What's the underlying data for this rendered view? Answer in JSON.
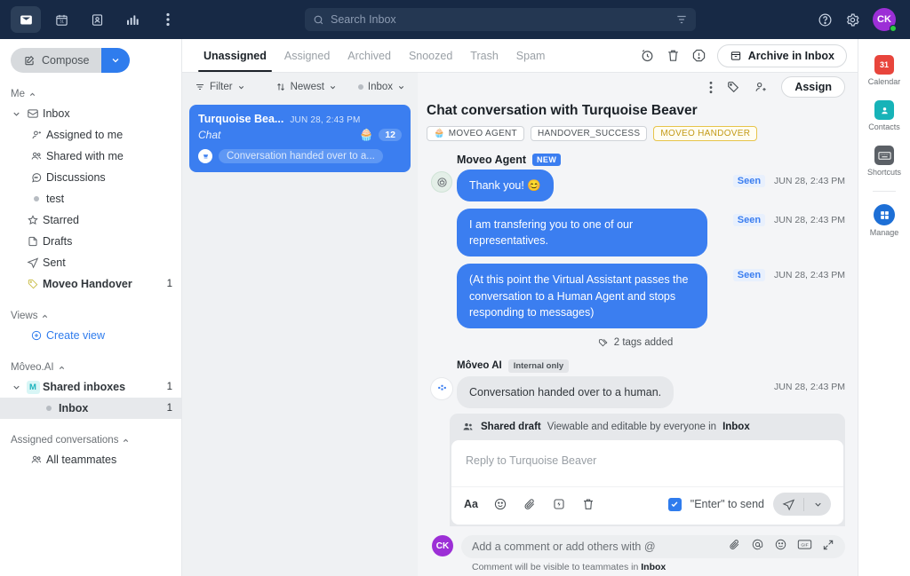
{
  "topbar": {
    "apps": [
      {
        "name": "inbox-app-icon",
        "label": "Inbox",
        "active": true
      },
      {
        "name": "calendar-app-icon",
        "label": "Calendar",
        "active": false
      },
      {
        "name": "contacts-app-icon",
        "label": "Contacts",
        "active": false
      },
      {
        "name": "analytics-app-icon",
        "label": "Analytics",
        "active": false
      },
      {
        "name": "more-options-icon",
        "label": "More",
        "active": false
      }
    ],
    "search": {
      "placeholder": "Search Inbox",
      "icon": "search-icon",
      "filter_icon": "filter-icon"
    },
    "help_icon": "help-circle-icon",
    "settings_icon": "gear-icon",
    "avatar_initials": "CK"
  },
  "sidebar": {
    "compose_label": "Compose",
    "groups": [
      {
        "title": "Me",
        "items": [
          {
            "label": "Inbox",
            "icon": "inbox-icon",
            "level": 1,
            "caret": "chevron-down",
            "count": "",
            "bold": false
          },
          {
            "label": "Assigned to me",
            "icon": "assigned-person-icon",
            "level": 2,
            "count": "",
            "bold": false
          },
          {
            "label": "Shared with me",
            "icon": "people-icon",
            "level": 2,
            "count": "",
            "bold": false
          },
          {
            "label": "Discussions",
            "icon": "chat-bubble-icon",
            "level": 2,
            "count": "",
            "bold": false
          },
          {
            "label": "test",
            "icon": "dot-icon",
            "level": 2,
            "count": "",
            "bold": false
          },
          {
            "label": "Starred",
            "icon": "star-icon",
            "level": 1,
            "count": "",
            "bold": false
          },
          {
            "label": "Drafts",
            "icon": "file-icon",
            "level": 1,
            "count": "",
            "bold": false
          },
          {
            "label": "Sent",
            "icon": "paper-plane-icon",
            "level": 1,
            "count": "",
            "bold": false
          },
          {
            "label": "Moveo Handover",
            "icon": "tag-icon",
            "level": 1,
            "count": "1",
            "bold": true
          }
        ]
      },
      {
        "title": "Views",
        "items": [
          {
            "label": "Create view",
            "icon": "plus-circle-icon",
            "level": 2,
            "count": "",
            "link": true
          }
        ]
      },
      {
        "title": "Môveo.AI",
        "items": [
          {
            "label": "Shared inboxes",
            "icon": "m-badge-icon",
            "level": 1,
            "caret": "chevron-down",
            "count": "1",
            "bold": true
          },
          {
            "label": "Inbox",
            "icon": "dot-icon",
            "level": 3,
            "count": "1",
            "bold": true,
            "selected": true
          }
        ]
      },
      {
        "title": "Assigned conversations",
        "items": [
          {
            "label": "All teammates",
            "icon": "people-icon",
            "level": 2,
            "count": ""
          }
        ]
      }
    ]
  },
  "tabs": [
    {
      "label": "Unassigned",
      "active": true
    },
    {
      "label": "Assigned",
      "active": false
    },
    {
      "label": "Archived",
      "active": false
    },
    {
      "label": "Snoozed",
      "active": false
    },
    {
      "label": "Trash",
      "active": false
    },
    {
      "label": "Spam",
      "active": false
    }
  ],
  "tab_actions": {
    "snooze_icon": "clock-snooze-icon",
    "trash_icon": "trash-icon",
    "report_icon": "alert-octagon-icon",
    "archive_label": "Archive in Inbox",
    "archive_icon": "archive-box-icon"
  },
  "list_toolbar": {
    "filter_label": "Filter",
    "filter_icon": "filter-icon",
    "sort_label": "Newest",
    "sort_icon": "sort-arrows-icon",
    "scope_label": "Inbox",
    "scope_icon": "dot-icon"
  },
  "conversation_list": [
    {
      "name": "Turquoise Bea...",
      "time": "JUN 28, 2:43 PM",
      "channel": "Chat",
      "emoji": "🧁",
      "count": "12",
      "snippet": "Conversation handed over to a...",
      "selected": true
    }
  ],
  "thread_toolbar": {
    "more_icon": "more-vertical-icon",
    "tag_icon": "tag-icon",
    "add_person_icon": "add-person-icon",
    "assign_label": "Assign"
  },
  "thread": {
    "title": "Chat conversation with Turquoise Beaver",
    "tags": [
      {
        "label": "MOVEO AGENT",
        "emoji": "🧁",
        "style": "default"
      },
      {
        "label": "HANDOVER_SUCCESS",
        "emoji": "",
        "style": "default"
      },
      {
        "label": "MOVEO HANDOVER",
        "emoji": "",
        "style": "yellow"
      }
    ],
    "messages": [
      {
        "sender": "Moveo Agent",
        "badge": "NEW",
        "badge_style": "new",
        "avatar": "bot-avatar-icon",
        "text": "Thank you! 😊",
        "bubble": "blue",
        "status": "Seen",
        "timestamp": "JUN 28, 2:43 PM"
      },
      {
        "sender": "",
        "badge": "",
        "avatar": "",
        "text": "I am transfering you to one of our representatives.",
        "bubble": "blue",
        "status": "Seen",
        "timestamp": "JUN 28, 2:43 PM"
      },
      {
        "sender": "",
        "badge": "",
        "avatar": "",
        "text": "(At this point the Virtual Assistant passes the conversation to a Human Agent and stops responding to messages)",
        "bubble": "blue",
        "status": "Seen",
        "timestamp": "JUN 28, 2:43 PM"
      }
    ],
    "system_event": {
      "text": "2 tags added",
      "icon": "tags-icon"
    },
    "internal_message": {
      "sender": "Môveo AI",
      "badge": "Internal only",
      "avatar": "moveo-ai-avatar-icon",
      "text": "Conversation handed over to a human.",
      "timestamp": "JUN 28, 2:43 PM"
    }
  },
  "composer": {
    "shared_draft_label": "Shared draft",
    "shared_draft_note_prefix": "Viewable and editable by everyone in ",
    "shared_draft_note_target": "Inbox",
    "shared_draft_icon": "people-filled-icon",
    "reply_placeholder": "Reply to Turquoise Beaver",
    "tools": [
      {
        "name": "text-format-icon",
        "glyph": "Aa"
      },
      {
        "name": "emoji-icon",
        "glyph": ""
      },
      {
        "name": "attachment-icon",
        "glyph": ""
      },
      {
        "name": "quick-reply-icon",
        "glyph": ""
      },
      {
        "name": "delete-draft-icon",
        "glyph": ""
      }
    ],
    "enter_to_send_label": "\"Enter\" to send",
    "enter_to_send_checked": true,
    "send_icon": "send-icon",
    "send_options_icon": "chevron-down-icon"
  },
  "comment_bar": {
    "avatar_initials": "CK",
    "placeholder": "Add a comment or add others with @",
    "note_prefix": "Comment will be visible to teammates in ",
    "note_target": "Inbox",
    "icons": [
      "attachment-icon",
      "mention-icon",
      "emoji-icon",
      "gif-icon",
      "expand-icon"
    ]
  },
  "rail": [
    {
      "label": "Calendar",
      "icon": "calendar-icon",
      "color": "#e8453c",
      "glyph": "31"
    },
    {
      "label": "Contacts",
      "icon": "contacts-icon",
      "color": "#17b3b8",
      "glyph": ""
    },
    {
      "label": "Shortcuts",
      "icon": "keyboard-icon",
      "color": "#5b6066",
      "glyph": ""
    },
    {
      "label": "Manage",
      "icon": "manage-grid-icon",
      "color": "#1d6fd6",
      "glyph": ""
    }
  ],
  "colors": {
    "topbar_bg": "#172945",
    "accent_blue": "#3b7ef0",
    "link_blue": "#2f7ced",
    "avatar_purple": "#9c2fd6",
    "tag_yellow": "#c39a17",
    "panel_gray": "#eff1f3"
  }
}
